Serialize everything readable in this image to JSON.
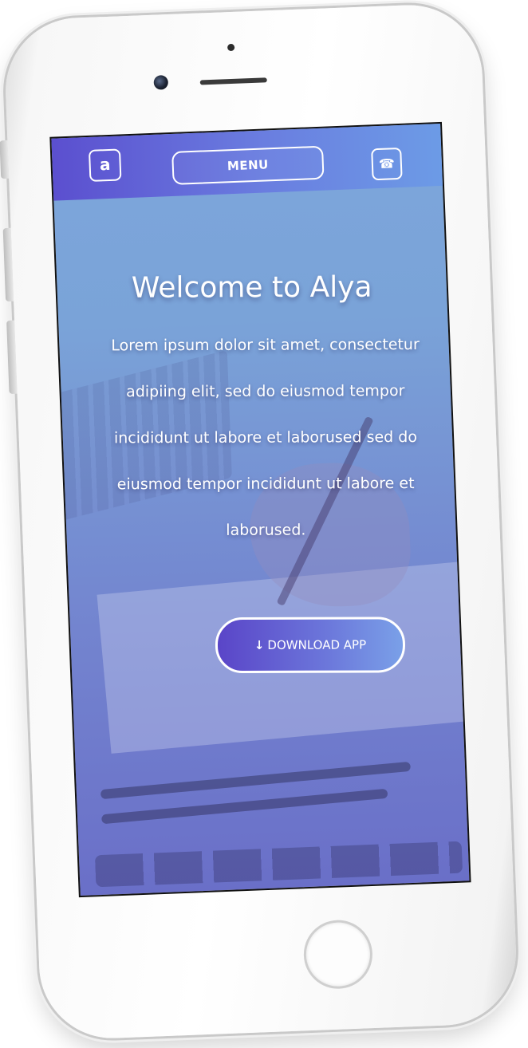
{
  "header": {
    "logo_letter": "a",
    "menu_label": "MENU",
    "phone_icon": "☎"
  },
  "hero": {
    "title": "Welcome to Alya",
    "description": "Lorem ipsum dolor sit amet, consectetur adipiing elit, sed do eiusmod tempor incididunt ut labore et laborused sed do eiusmod tempor incididunt ut labore et laborused.",
    "cta_icon": "↓",
    "cta_label": "DOWNLOAD APP"
  },
  "colors": {
    "accent_purple": "#5b4fcf",
    "accent_blue": "#6c9be6",
    "text": "#ffffff"
  }
}
